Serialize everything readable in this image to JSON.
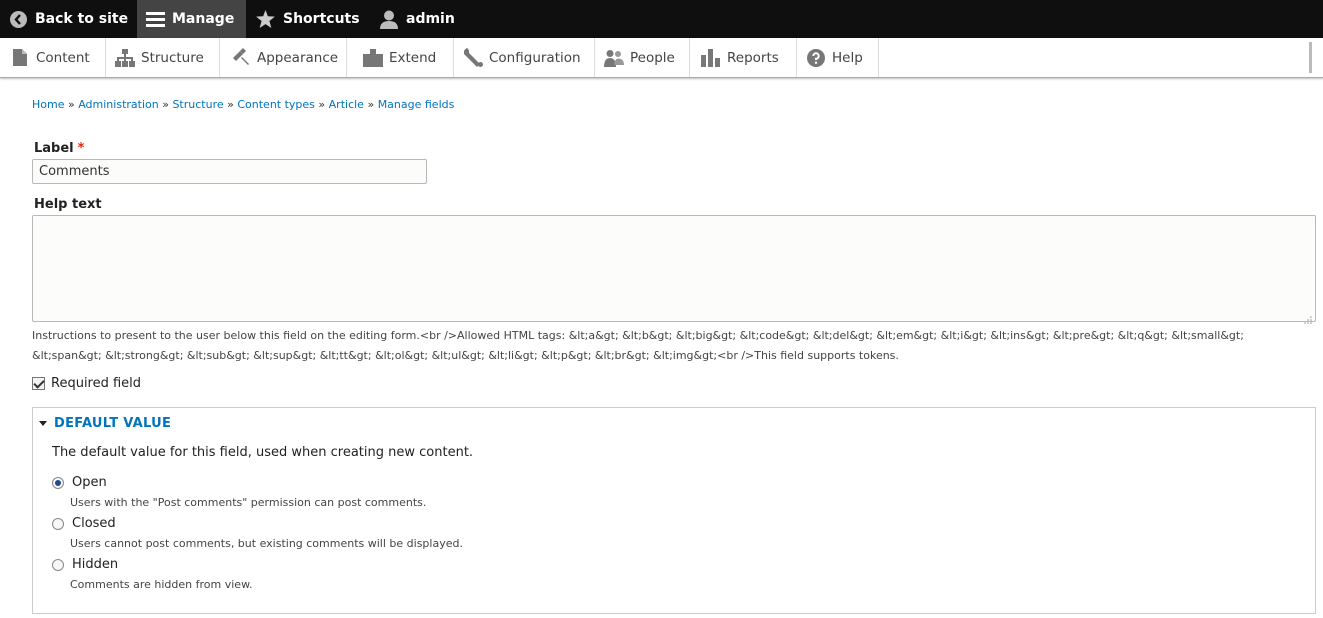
{
  "toolbar": {
    "back_to_site": "Back to site",
    "manage": "Manage",
    "shortcuts": "Shortcuts",
    "user": "admin"
  },
  "tray": {
    "items": [
      {
        "label": "Content",
        "icon": "file-icon"
      },
      {
        "label": "Structure",
        "icon": "sitemap-icon"
      },
      {
        "label": "Appearance",
        "icon": "paintbrush-icon"
      },
      {
        "label": "Extend",
        "icon": "puzzle-icon"
      },
      {
        "label": "Configuration",
        "icon": "wrench-icon"
      },
      {
        "label": "People",
        "icon": "people-icon"
      },
      {
        "label": "Reports",
        "icon": "bar-chart-icon"
      },
      {
        "label": "Help",
        "icon": "help-icon"
      }
    ]
  },
  "breadcrumb": {
    "items": [
      "Home",
      "Administration",
      "Structure",
      "Content types",
      "Article",
      "Manage fields"
    ],
    "separator": "»"
  },
  "form": {
    "label_title": "Label",
    "required_marker": "*",
    "label_value": "Comments",
    "help_text_title": "Help text",
    "help_text_value": "",
    "help_description": "Instructions to present to the user below this field on the editing form.<br />Allowed HTML tags: &lt;a&gt; &lt;b&gt; &lt;big&gt; &lt;code&gt; &lt;del&gt; &lt;em&gt; &lt;i&gt; &lt;ins&gt; &lt;pre&gt; &lt;q&gt; &lt;small&gt; &lt;span&gt; &lt;strong&gt; &lt;sub&gt; &lt;sup&gt; &lt;tt&gt; &lt;ol&gt; &lt;ul&gt; &lt;li&gt; &lt;p&gt; &lt;br&gt; &lt;img&gt;<br />This field supports tokens.",
    "required_field_label": "Required field",
    "required_checked": true
  },
  "default_value": {
    "legend": "DEFAULT VALUE",
    "description": "The default value for this field, used when creating new content.",
    "options": [
      {
        "label": "Open",
        "description": "Users with the \"Post comments\" permission can post comments.",
        "selected": true
      },
      {
        "label": "Closed",
        "description": "Users cannot post comments, but existing comments will be displayed.",
        "selected": false
      },
      {
        "label": "Hidden",
        "description": "Comments are hidden from view.",
        "selected": false
      }
    ]
  },
  "colors": {
    "link": "#0074bd",
    "toolbar_bg": "#0f0f0f",
    "required": "#e32700"
  }
}
